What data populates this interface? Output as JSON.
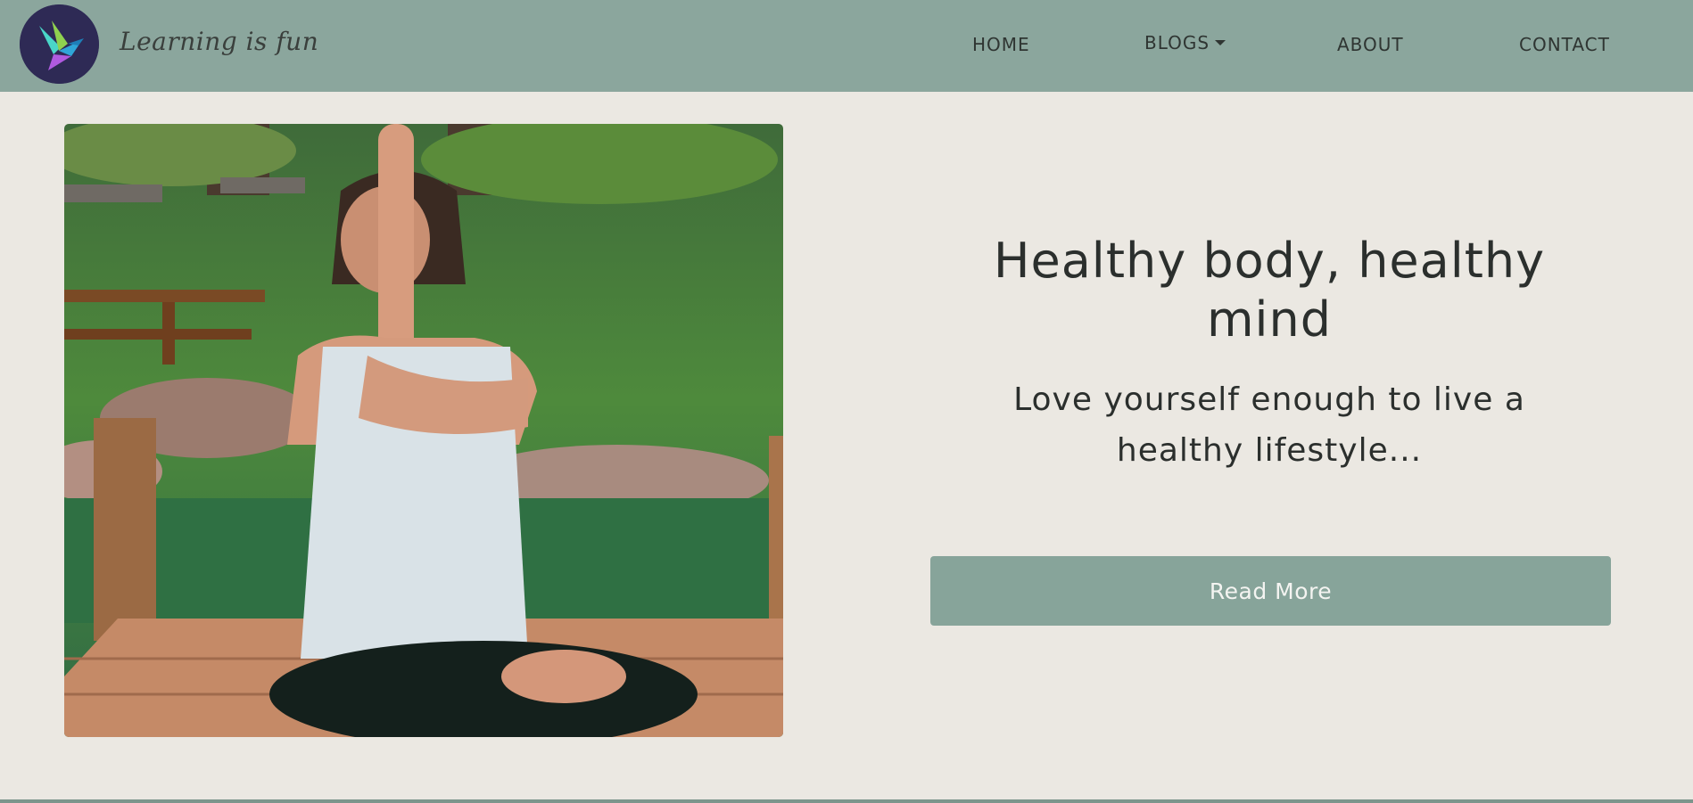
{
  "brand": {
    "logo_icon": "bird-logo-icon",
    "tagline": "Learning is fun"
  },
  "nav": {
    "items": [
      {
        "label": "HOME"
      },
      {
        "label": "BLOGS",
        "icon": "caret-down-icon"
      },
      {
        "label": "ABOUT"
      },
      {
        "label": "CONTACT"
      }
    ]
  },
  "hero": {
    "image_icon": "yoga-woman-photo",
    "title": "Healthy body, healthy mind",
    "subtitle": "Love yourself enough to live a healthy lifestyle...",
    "button_label": "Read More"
  },
  "colors": {
    "navbar": "#8ba69d",
    "page_background": "#ebe8e2",
    "button": "#87a49a",
    "text": "#2b2f2d"
  }
}
